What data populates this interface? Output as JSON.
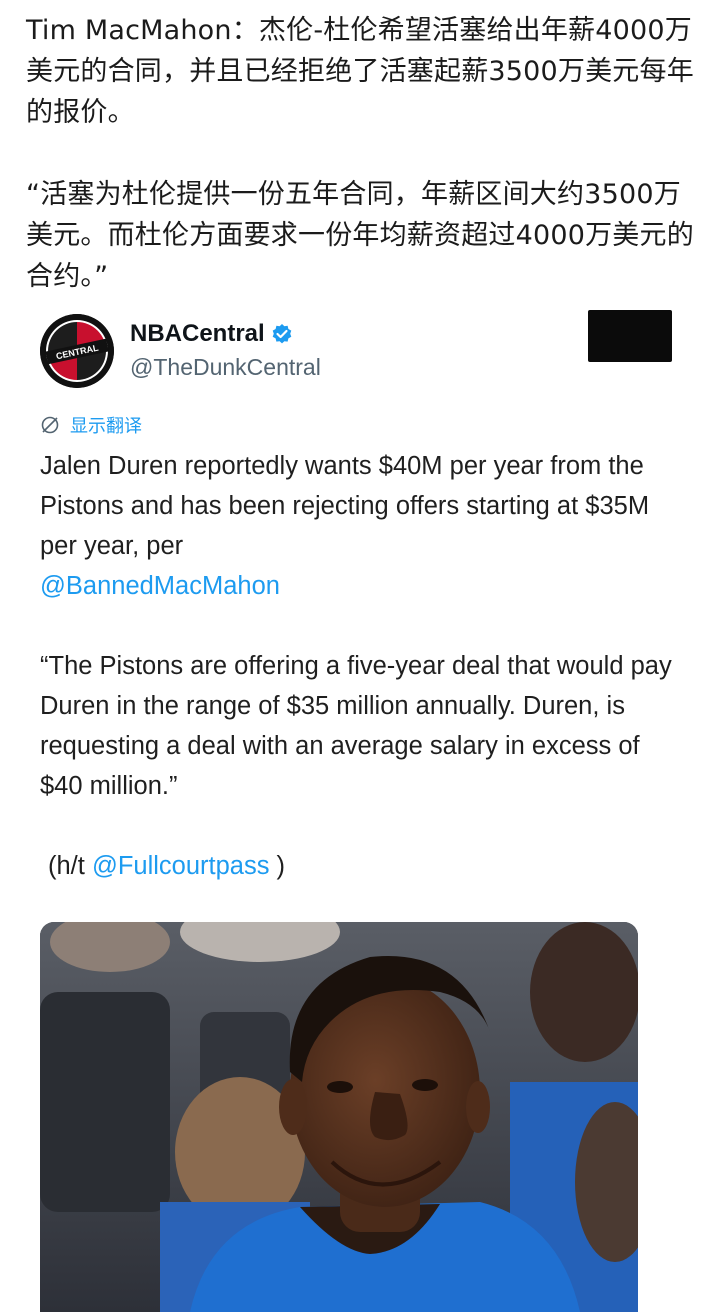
{
  "post": {
    "paragraph1": "Tim MacMahon：杰伦-杜伦希望活塞给出年薪4000万美元的合同，并且已经拒绝了活塞起薪3500万美元每年的报价。",
    "paragraph2": "“活塞为杜伦提供一份五年合同，年薪区间大约3500万美元。而杜伦方面要求一份年均薪资超过4000万美元的合约。”"
  },
  "tweet": {
    "display_name": "NBACentral",
    "handle": "@TheDunkCentral",
    "avatar_text": "CENTRAL",
    "translate_label": "显示翻译",
    "line1": "Jalen Duren reportedly wants $40M per year from the Pistons and has been rejecting offers starting at $35M per year, per",
    "mention1": "@BannedMacMahon",
    "quote": "“The Pistons are offering a five-year deal that would pay Duren in the range of $35 million annually. Duren, is requesting a deal with an average salary in excess of $40 million.”",
    "hat_prefix": "(h/t ",
    "hat_mention": "@Fullcourtpass",
    "hat_suffix": " )"
  },
  "colors": {
    "link": "#1d9bf0",
    "verified": "#1d9bf0",
    "handle": "#536471",
    "jersey": "#1f6fd0"
  },
  "icons": {
    "verified": "verified-badge-icon",
    "translate": "globe-icon"
  }
}
